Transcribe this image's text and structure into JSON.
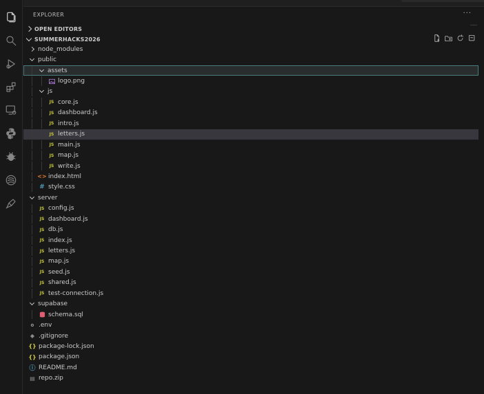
{
  "activity_bar": {
    "icons": [
      "files-icon",
      "search-icon",
      "run-debug-icon",
      "extensions-icon",
      "remote-explorer-icon",
      "python-icon",
      "testing-icon",
      "database-icon",
      "deploy-icon"
    ]
  },
  "explorer": {
    "title": "EXPLORER",
    "more": "···",
    "open_editors": "OPEN EDITORS",
    "project": "SUMMERHACKS2026"
  },
  "tree": [
    {
      "label": "node_modules",
      "depth": 0,
      "kind": "folder",
      "open": false
    },
    {
      "label": "public",
      "depth": 0,
      "kind": "folder",
      "open": true
    },
    {
      "label": "assets",
      "depth": 1,
      "kind": "folder",
      "open": true,
      "selected": true
    },
    {
      "label": "logo.png",
      "depth": 2,
      "kind": "image"
    },
    {
      "label": "js",
      "depth": 1,
      "kind": "folder",
      "open": true
    },
    {
      "label": "core.js",
      "depth": 2,
      "kind": "js"
    },
    {
      "label": "dashboard.js",
      "depth": 2,
      "kind": "js"
    },
    {
      "label": "intro.js",
      "depth": 2,
      "kind": "js"
    },
    {
      "label": "letters.js",
      "depth": 2,
      "kind": "js",
      "hover": true
    },
    {
      "label": "main.js",
      "depth": 2,
      "kind": "js"
    },
    {
      "label": "map.js",
      "depth": 2,
      "kind": "js"
    },
    {
      "label": "write.js",
      "depth": 2,
      "kind": "js"
    },
    {
      "label": "index.html",
      "depth": 1,
      "kind": "html"
    },
    {
      "label": "style.css",
      "depth": 1,
      "kind": "css"
    },
    {
      "label": "server",
      "depth": 0,
      "kind": "folder",
      "open": true
    },
    {
      "label": "config.js",
      "depth": 1,
      "kind": "js"
    },
    {
      "label": "dashboard.js",
      "depth": 1,
      "kind": "js"
    },
    {
      "label": "db.js",
      "depth": 1,
      "kind": "js"
    },
    {
      "label": "index.js",
      "depth": 1,
      "kind": "js"
    },
    {
      "label": "letters.js",
      "depth": 1,
      "kind": "js"
    },
    {
      "label": "map.js",
      "depth": 1,
      "kind": "js"
    },
    {
      "label": "seed.js",
      "depth": 1,
      "kind": "js"
    },
    {
      "label": "shared.js",
      "depth": 1,
      "kind": "js"
    },
    {
      "label": "test-connection.js",
      "depth": 1,
      "kind": "js"
    },
    {
      "label": "supabase",
      "depth": 0,
      "kind": "folder",
      "open": true
    },
    {
      "label": "schema.sql",
      "depth": 1,
      "kind": "sql"
    },
    {
      "label": ".env",
      "depth": 0,
      "kind": "env"
    },
    {
      "label": ".gitignore",
      "depth": 0,
      "kind": "git"
    },
    {
      "label": "package-lock.json",
      "depth": 0,
      "kind": "json"
    },
    {
      "label": "package.json",
      "depth": 0,
      "kind": "json"
    },
    {
      "label": "README.md",
      "depth": 0,
      "kind": "info"
    },
    {
      "label": "repo.zip",
      "depth": 0,
      "kind": "zip"
    }
  ],
  "icon_glyphs": {
    "js": "JS",
    "html": "<>",
    "css": "#",
    "json": "{}",
    "env": "⚙",
    "git": "◆",
    "info": "ⓘ",
    "zip": "▤"
  },
  "colors": {
    "background": "#181818",
    "selected_border": "#4a7c7c",
    "hover_background": "#37373d",
    "js_icon": "#cbcb41",
    "sql_icon": "#e05d73",
    "image_icon": "#a074c4"
  }
}
